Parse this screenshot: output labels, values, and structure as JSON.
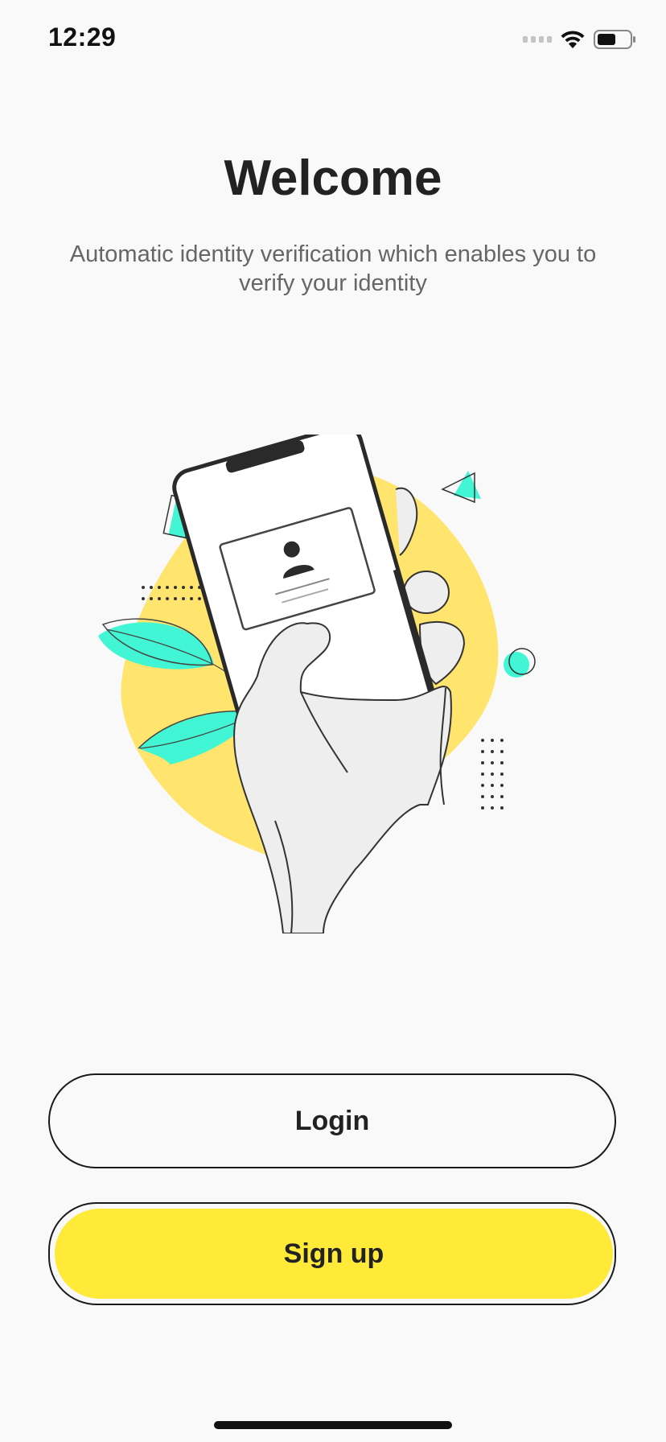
{
  "status_bar": {
    "time": "12:29",
    "signal_icon": "signal-dots-icon",
    "wifi_icon": "wifi-icon",
    "battery_icon": "battery-icon"
  },
  "header": {
    "title": "Welcome",
    "subtitle": "Automatic identity verification which enables you to verify your identity"
  },
  "illustration": {
    "icon": "hand-holding-phone-id-illustration",
    "colors": {
      "blob": "#ffe46e",
      "accent": "#42f5d4",
      "phone_frame": "#2a2a2a",
      "hand": "#eeeeee"
    }
  },
  "actions": {
    "login_label": "Login",
    "signup_label": "Sign up",
    "signup_color": "#ffea39"
  }
}
